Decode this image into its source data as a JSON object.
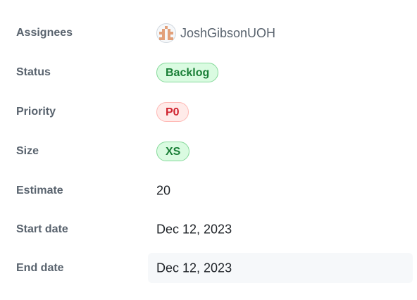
{
  "fields": {
    "assignees": {
      "label": "Assignees",
      "user": "JoshGibsonUOH",
      "avatar_icon": "identicon-avatar"
    },
    "status": {
      "label": "Status",
      "value": "Backlog",
      "color": "#1a7f37"
    },
    "priority": {
      "label": "Priority",
      "value": "P0",
      "color": "#cf222e"
    },
    "size": {
      "label": "Size",
      "value": "XS",
      "color": "#1a7f37"
    },
    "estimate": {
      "label": "Estimate",
      "value": "20"
    },
    "start_date": {
      "label": "Start date",
      "value": "Dec 12, 2023"
    },
    "end_date": {
      "label": "End date",
      "value": "Dec 12, 2023"
    }
  }
}
